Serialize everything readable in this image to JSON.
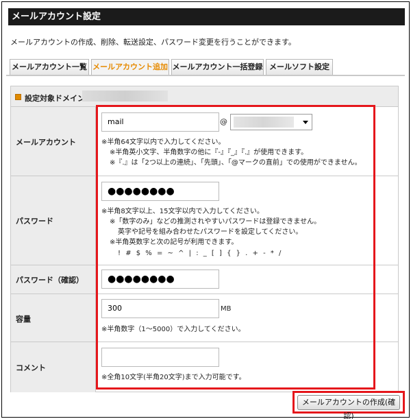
{
  "header": {
    "title": "メールアカウント設定"
  },
  "description": "メールアカウントの作成、削除、転送設定、パスワード変更を行うことができます。",
  "tabs": [
    {
      "label": "メールアカウント一覧",
      "active": false
    },
    {
      "label": "メールアカウント追加",
      "active": true
    },
    {
      "label": "メールアカウント一括登録",
      "active": false
    },
    {
      "label": "メールソフト設定",
      "active": false
    }
  ],
  "domain": {
    "label": "設定対象ドメイン"
  },
  "form": {
    "account": {
      "label": "メールアカウント",
      "value": "mail",
      "at": "@",
      "notes": [
        "※半角64文字以内で入力してください。",
        "※半角英小文字、半角数字の他に『-』『_』『.』が使用できます。",
        "※『.』は「2つ以上の連続」、「先頭」、「@マークの直前」での使用ができません。"
      ]
    },
    "password": {
      "label": "パスワード",
      "value": "●●●●●●●●",
      "notes": [
        "※半角8文字以上、15文字以内で入力してください。",
        "※「数字のみ」などの推測されやすいパスワードは登録できません。",
        "英字や記号を組み合わせたパスワードを設定してください。",
        "※半角英数字と次の記号が利用できます。",
        "! # $ % = ~ ^ | : _ [ ] { } . + - * /"
      ]
    },
    "password_confirm": {
      "label": "パスワード（確認）",
      "value": "●●●●●●●●"
    },
    "quota": {
      "label": "容量",
      "value": "300",
      "unit": "MB",
      "note": "※半角数字（1〜5000）で入力してください。"
    },
    "comment": {
      "label": "コメント",
      "value": "",
      "note": "※全角10文字(半角20文字)まで入力可能です。"
    }
  },
  "submit": {
    "label": "メールアカウントの作成(確認)"
  },
  "colors": {
    "highlight": "#e5161b",
    "active_tab": "#e68a00",
    "title_bar": "#1b1b1b"
  }
}
